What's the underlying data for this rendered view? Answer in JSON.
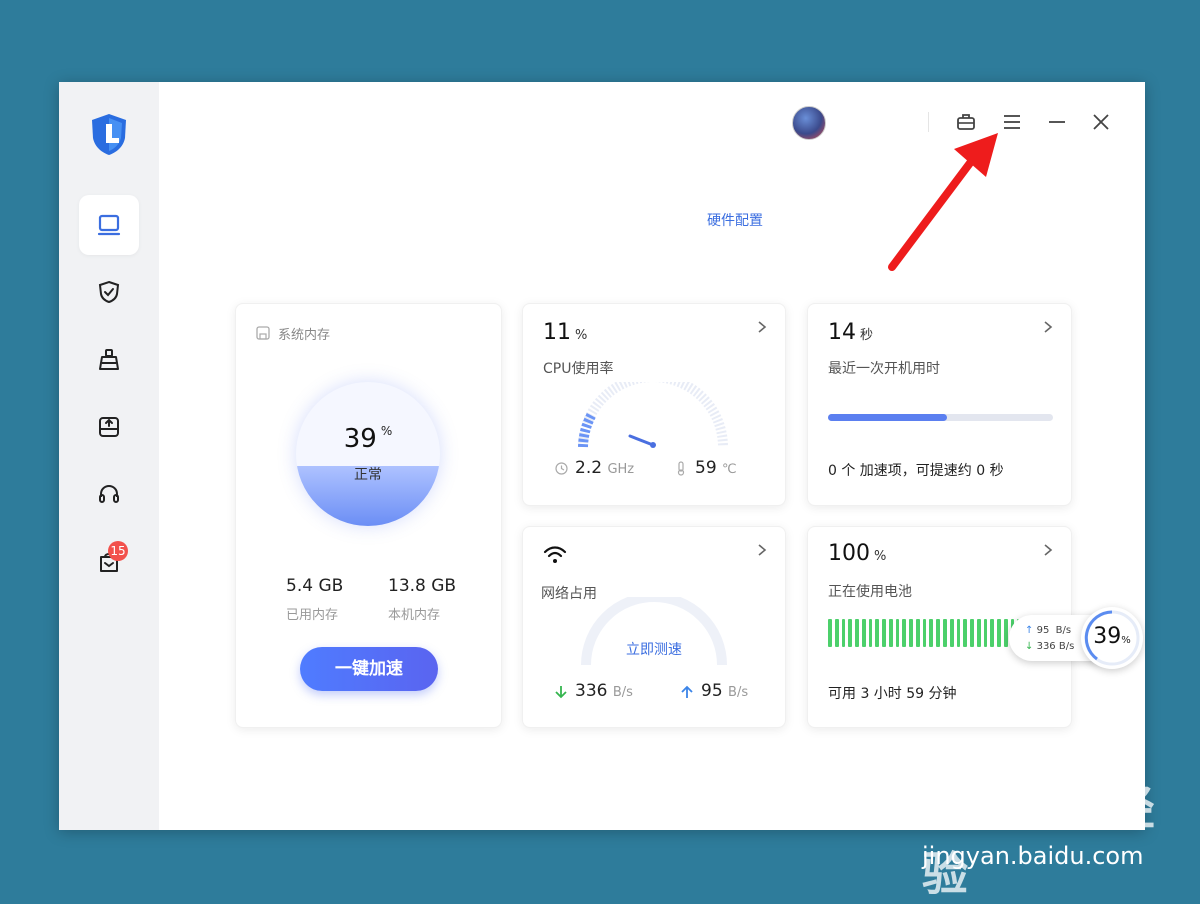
{
  "toolbar": {
    "icons": [
      "toolbox-icon",
      "menu-icon",
      "minimize-icon",
      "close-icon"
    ]
  },
  "hardware_link": "硬件配置",
  "sidebar": {
    "items": [
      "monitor-icon",
      "shield-icon",
      "clean-icon",
      "disk-icon",
      "headset-icon",
      "message-icon"
    ],
    "badge": "15"
  },
  "memory": {
    "title": "系统内存",
    "percent": "39",
    "percent_unit": "%",
    "status": "正常",
    "used_value": "5.4 GB",
    "used_label": "已用内存",
    "total_value": "13.8 GB",
    "total_label": "本机内存",
    "button": "一键加速"
  },
  "cpu": {
    "value": "11",
    "unit": "%",
    "label": "CPU使用率",
    "freq": "2.2",
    "freq_unit": "GHz",
    "temp": "59",
    "temp_unit": "℃"
  },
  "boot": {
    "value": "14",
    "unit": "秒",
    "label": "最近一次开机用时",
    "progress": 0.53,
    "note": "0 个 加速项，可提速约 0 秒"
  },
  "network": {
    "label": "网络占用",
    "test_button": "立即测速",
    "down": "336",
    "down_unit": "B/s",
    "up": "95",
    "up_unit": "B/s"
  },
  "battery": {
    "value": "100",
    "unit": "%",
    "label": "正在使用电池",
    "level": 1.0,
    "remaining": "可用 3 小时 59 分钟"
  },
  "float_widget": {
    "up": "95",
    "up_unit": "B/s",
    "down": "336",
    "down_unit": "B/s",
    "percent": "39",
    "percent_unit": "%"
  },
  "watermark": {
    "brand": "Bai du 经验",
    "url": "jingyan.baidu.com"
  },
  "colors": {
    "accent": "#4f7cff",
    "battery": "#4cd06b",
    "badge": "#f2514c",
    "annotation_arrow": "#ee1c1c"
  }
}
